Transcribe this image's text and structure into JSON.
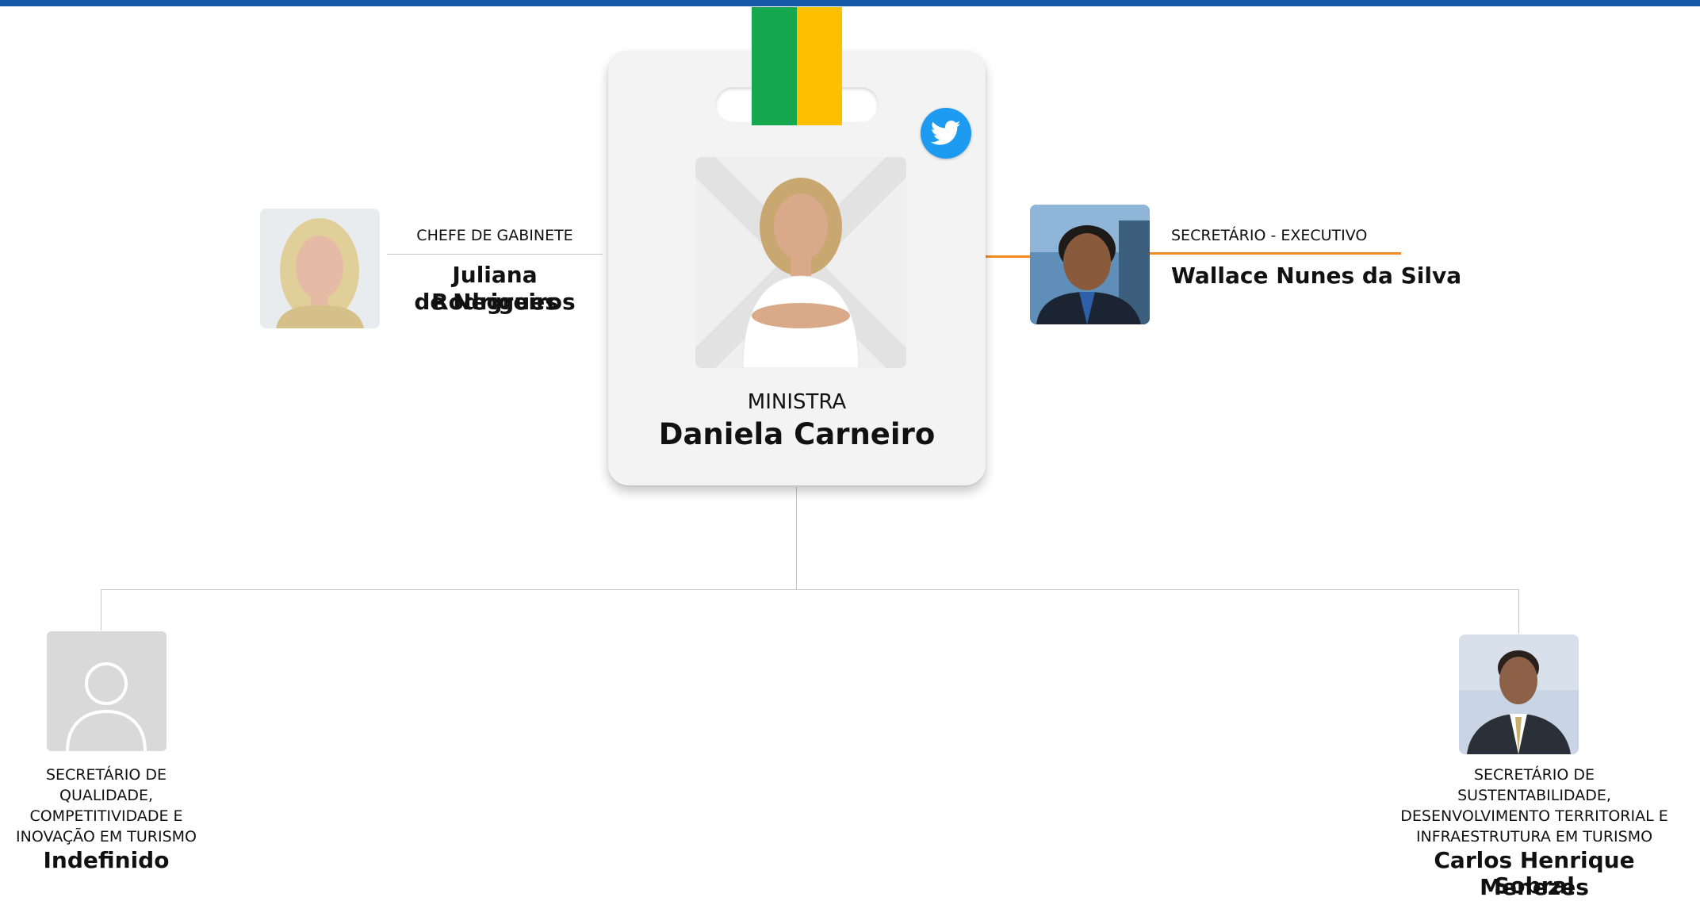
{
  "org_chart": {
    "minister": {
      "role": "MINISTRA",
      "name": "Daniela Carneiro",
      "social_icon": "twitter-icon",
      "badge_colors": {
        "green": "#15a84e",
        "yellow": "#fdbf00"
      }
    },
    "chief_of_staff": {
      "role": "CHEFE DE GABINETE",
      "name_line1": "Juliana Rodrigues",
      "name_line2": "de Negreiros"
    },
    "executive_secretary": {
      "role": "SECRETÁRIO - EXECUTIVO",
      "name": "Wallace Nunes da Silva"
    },
    "secretary_quality": {
      "role_lines": [
        "SECRETÁRIO DE",
        "QUALIDADE,",
        "COMPETITIVIDADE E",
        "INOVAÇÃO EM TURISMO"
      ],
      "name": "Indefinido",
      "photo": "user-placeholder-icon"
    },
    "secretary_sustainability": {
      "role_lines": [
        "SECRETÁRIO DE",
        "SUSTENTABILIDADE,",
        "DESENVOLVIMENTO TERRITORIAL E",
        "INFRAESTRUTURA EM TURISMO"
      ],
      "name_line1": "Carlos Henrique Menezes",
      "name_line2": "Sobral"
    }
  }
}
